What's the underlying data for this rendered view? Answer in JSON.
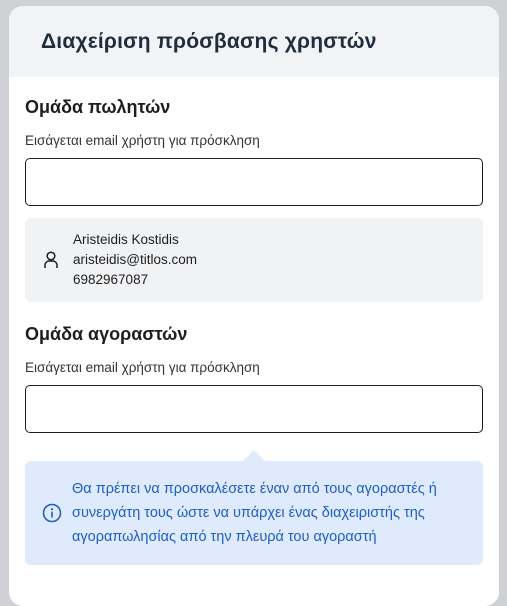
{
  "modal": {
    "title": "Διαχείριση πρόσβασης χρηστών"
  },
  "sellers": {
    "title": "Ομάδα πωλητών",
    "input_label": "Εισάγεται email χρήστη για πρόσκληση",
    "input_value": "",
    "user": {
      "icon": "user-icon",
      "name": "Aristeidis Kostidis",
      "email": "aristeidis@titlos.com",
      "phone": "6982967087"
    }
  },
  "buyers": {
    "title": "Ομάδα αγοραστών",
    "input_label": "Εισάγεται email χρήστη για πρόσκληση",
    "input_value": ""
  },
  "info": {
    "icon": "info-icon",
    "text": "Θα πρέπει να προσκαλέσετε έναν από τους αγοραστές ή συνεργάτη τους ώστε να υπάρχει ένας διαχειριστής της αγοραπωλησίας από την πλευρά του αγοραστή"
  },
  "colors": {
    "overlay": "#cfd1d5",
    "header_bg": "#f2f3f5",
    "title_text": "#1f2d3d",
    "card_bg": "#f1f2f4",
    "info_bg": "#dfeafc",
    "info_text": "#1d5fc4"
  }
}
